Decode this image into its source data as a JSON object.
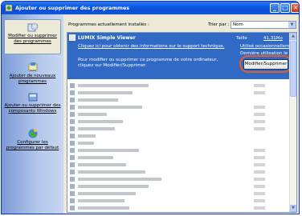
{
  "window": {
    "title": "Ajouter ou supprimer des programmes",
    "min": "_",
    "max": "□",
    "close": "✕"
  },
  "sidebar": {
    "items": [
      {
        "label": "Modifier ou supprimer des programmes",
        "icon": "programs-cd-icon"
      },
      {
        "label": "Ajouter de nouveaux programmes",
        "icon": "add-program-icon"
      },
      {
        "label": "Ajouter ou supprimer des composants Windows",
        "icon": "windows-components-icon"
      },
      {
        "label": "Configurer les programmes par défaut",
        "icon": "default-programs-globe-icon"
      }
    ]
  },
  "header": {
    "installed_label": "Programmes actuellement installés :",
    "sort_label": "Trier par :",
    "sort_value": "Nom"
  },
  "selected_program": {
    "name": "LUMIX Simple Viewer",
    "size_label": "Taille",
    "size_value": "41,31Mo",
    "support_link": "Cliquez ici pour obtenir des informations sur le support technique.",
    "used_value": "Utilisé occasionnellement",
    "last_used_label": "Dernière utilisation le",
    "description": "Pour modifier ou supprimer ce programme de votre ordinateur, cliquez sur Modifier/Supprimer.",
    "button_label": "Modifier/Supprimer"
  },
  "colors": {
    "selection": "#316ac5",
    "highlight_ring": "#f05a1e",
    "titlebar": "#0a58e3"
  }
}
